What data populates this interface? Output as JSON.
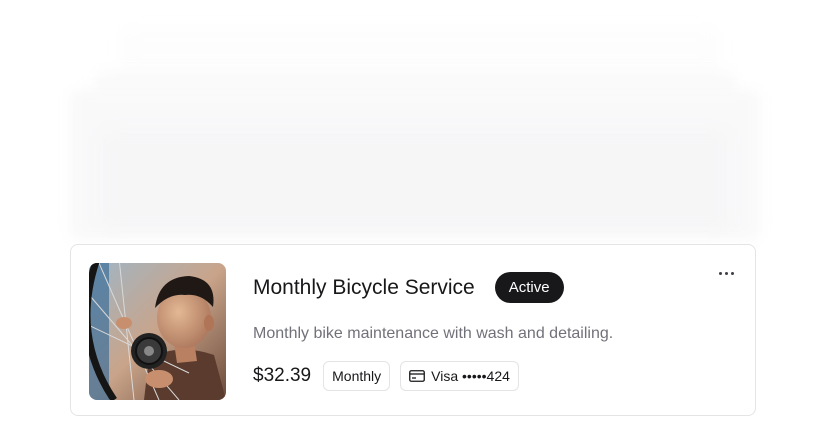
{
  "subscription": {
    "title": "Monthly Bicycle Service",
    "status": "Active",
    "description": "Monthly bike maintenance with wash and detailing.",
    "price": "$32.39",
    "frequency": "Monthly",
    "payment_method": "Visa •••••424",
    "image_alt": "mechanic servicing a bicycle wheel",
    "more_icon": "ellipsis-icon",
    "payment_icon": "credit-card-icon"
  },
  "colors": {
    "badge_bg": "#18181b",
    "border": "#e4e4e7",
    "muted_text": "#71717a"
  }
}
